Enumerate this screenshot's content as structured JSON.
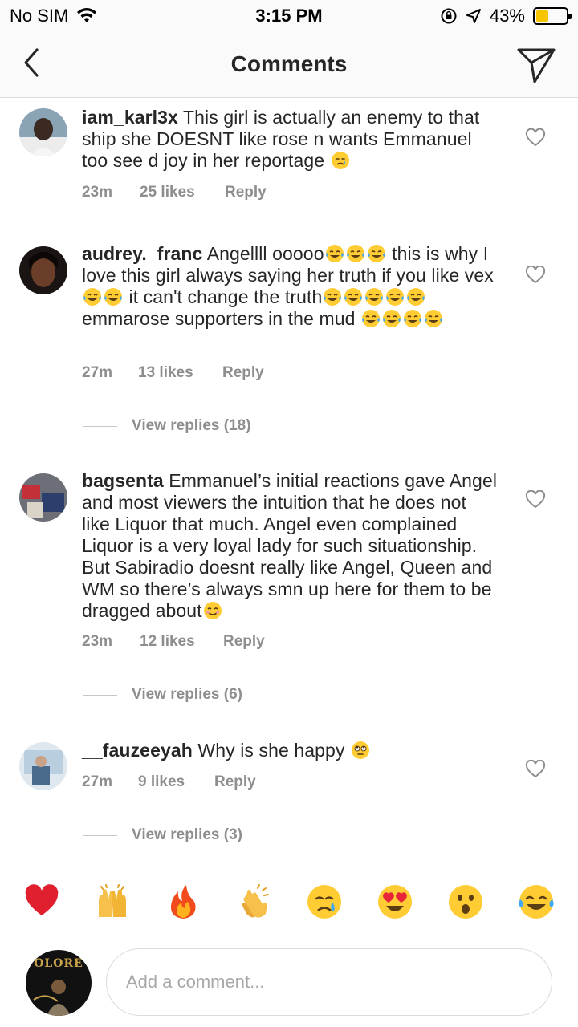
{
  "status_bar": {
    "carrier": "No SIM",
    "time": "3:15 PM",
    "battery": "43%",
    "battery_level": 0.43
  },
  "header": {
    "title": "Comments",
    "back_icon": "chevron-left-icon",
    "send_icon": "paper-plane-icon"
  },
  "comments": [
    {
      "username": "iam_karl3x",
      "segments": [
        "This girl is actually an enemy to that ship she DOESNT like rose n wants Emmanuel too see d joy in her reportage"
      ],
      "time": "23m",
      "likes": "25 likes",
      "reply": "Reply"
    },
    {
      "username": "audrey._franc",
      "segments": [
        "Angellll ooooo",
        " this is why I love this girl always saying her truth if you like vex",
        " it can't change the truth",
        "emmarose supporters in the mud"
      ],
      "time": "27m",
      "likes": "13 likes",
      "reply": "Reply",
      "view_replies": "View replies (18)"
    },
    {
      "username": "bagsenta",
      "segments": [
        "Emmanuel’s initial reactions gave Angel and most viewers the intuition that he does not like Liquor that much. Angel even complained Liquor is a very loyal lady for such situationship. But Sabiradio doesnt really like Angel, Queen and WM so there’s always smn up here for them to be dragged about"
      ],
      "time": "23m",
      "likes": "12 likes",
      "reply": "Reply",
      "view_replies": "View replies (6)"
    },
    {
      "username": "__fauzeeyah",
      "segments": [
        "Why is she happy"
      ],
      "time": "27m",
      "likes": "9 likes",
      "reply": "Reply",
      "view_replies": "View replies (3)"
    }
  ],
  "reactions": [
    "red-heart",
    "raising-hands",
    "fire",
    "clapping-hands",
    "crying-face",
    "heart-eyes",
    "astonished-face",
    "tears-of-joy"
  ],
  "composer": {
    "placeholder": "Add a comment...",
    "avatar_text": "OLORE"
  },
  "colors": {
    "text": "#262626",
    "meta": "#8e8e8e",
    "divider": "#dbdbdb",
    "emoji_yellow": "#ffcc33",
    "battery": "#f7c500"
  }
}
